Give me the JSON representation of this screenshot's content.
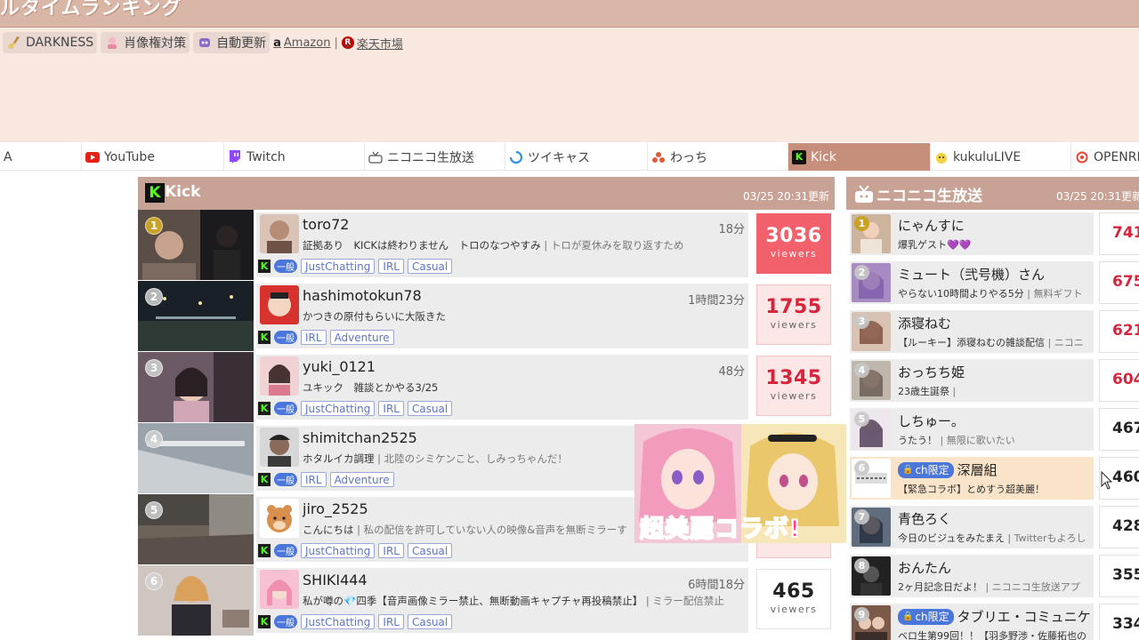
{
  "header": {
    "title": "ルタイムランキング",
    "tools": [
      {
        "icon": "broom-icon",
        "label": "DARKNESS"
      },
      {
        "icon": "portrait-icon",
        "label": "肖像権対策"
      },
      {
        "icon": "robot-icon",
        "label": "自動更新"
      }
    ],
    "amazon": "Amazon",
    "separator": "|",
    "rakuten": "楽天市場"
  },
  "tabs": [
    {
      "label": "A",
      "icon": ""
    },
    {
      "label": "YouTube",
      "icon": "youtube-icon"
    },
    {
      "label": "Twitch",
      "icon": "twitch-icon"
    },
    {
      "label": "ニコニコ生放送",
      "icon": "niconico-icon"
    },
    {
      "label": "ツイキャス",
      "icon": "twitcasting-icon"
    },
    {
      "label": "わっち",
      "icon": "wacchi-icon"
    },
    {
      "label": "Kick",
      "icon": "kick-icon"
    },
    {
      "label": "kukuluLIVE",
      "icon": "kukulu-icon"
    },
    {
      "label": "OPENRE",
      "icon": "openrec-icon"
    }
  ],
  "kick_panel": {
    "title": "Kick",
    "updated": "03/25 20:31更新",
    "viewers_label": "viewers",
    "ippan": "一般",
    "rows": [
      {
        "rank": "1",
        "name": "toro72",
        "duration": "18分",
        "title": "証拠あり　KICKは終わりません　トロのなつやすみ",
        "sub": " | トロが夏休みを取り返すため",
        "tags": [
          "JustChatting",
          "IRL",
          "Casual"
        ],
        "viewers": "3036"
      },
      {
        "rank": "2",
        "name": "hashimotokun78",
        "duration": "1時間23分",
        "title": "かつきの原付もらいに大阪きた",
        "sub": "",
        "tags": [
          "IRL",
          "Adventure"
        ],
        "viewers": "1755"
      },
      {
        "rank": "3",
        "name": "yuki_0121",
        "duration": "48分",
        "title": "ユキック　雑談とかやる3/25",
        "sub": "",
        "tags": [
          "JustChatting",
          "IRL",
          "Casual"
        ],
        "viewers": "1345"
      },
      {
        "rank": "4",
        "name": "shimitchan2525",
        "duration": "",
        "title": "ホタルイカ調理",
        "sub": " | 北陸のシミケンこと、しみっちゃんだ！",
        "tags": [
          "IRL",
          "Adventure"
        ],
        "viewers": ""
      },
      {
        "rank": "5",
        "name": "jiro_2525",
        "duration": "",
        "title": "こんにちは",
        "sub": " | 私の配信を許可していない人の映像&音声を無断ミラーす",
        "tags": [
          "JustChatting",
          "IRL",
          "Casual"
        ],
        "viewers": ""
      },
      {
        "rank": "6",
        "name": "SHIKI444",
        "duration": "6時間18分",
        "title": "私が噂の💎四季【音声画像ミラー禁止、無断動画キャプチャ再投稿禁止】",
        "sub": " | ミラー配信禁止",
        "tags": [
          "JustChatting",
          "IRL",
          "Casual"
        ],
        "viewers": "465"
      }
    ]
  },
  "nico_panel": {
    "title": "ニコニコ生放送",
    "updated": "03/25 20:31更新",
    "ch_badge": "ch限定",
    "rows": [
      {
        "rank": "1",
        "name": "にゃんすに",
        "sub": "爆乳ゲスト💜💜",
        "sub2": "",
        "ch": false,
        "viewers": "741"
      },
      {
        "rank": "2",
        "name": "ミュート（弐号機）さん",
        "sub": "やらない10時間よりやる5分",
        "sub2": " | 無料ギフト",
        "ch": false,
        "viewers": "675"
      },
      {
        "rank": "3",
        "name": "添寝ねむ",
        "sub": "【ルーキー】添寝ねむの雑談配信",
        "sub2": " | ニコニ",
        "ch": false,
        "viewers": "621"
      },
      {
        "rank": "4",
        "name": "おっちち姫",
        "sub": "23歳生誕祭",
        "sub2": " |",
        "ch": false,
        "viewers": "604"
      },
      {
        "rank": "5",
        "name": "しちゅー。",
        "sub": "うたう！",
        "sub2": " | 無限に歌いたい",
        "ch": false,
        "viewers": "467"
      },
      {
        "rank": "6",
        "name": "深層組",
        "sub": "【緊急コラボ】とめすう超美麗！",
        "sub2": "",
        "ch": true,
        "viewers": "460"
      },
      {
        "rank": "7",
        "name": "青色ろく",
        "sub": "今日のビジュをみたまえ",
        "sub2": " | Twitterもよろし",
        "ch": false,
        "viewers": "428"
      },
      {
        "rank": "8",
        "name": "おんたん",
        "sub": "2ヶ月記念日だよ！",
        "sub2": " | ニコニコ生放送アプ",
        "ch": false,
        "viewers": "355"
      },
      {
        "rank": "9",
        "name": "タブリエ・コミュニケ",
        "sub": "ベロ生第99回！！【羽多野渉・佐藤拓也の",
        "sub2": "",
        "ch": true,
        "viewers": "334"
      }
    ]
  },
  "collab": {
    "text": "超美麗コラボ!"
  },
  "colors": {
    "accent": "#c8a294",
    "kick_green": "#53fc18",
    "viewer_red": "#d9233a",
    "tag_blue": "#5f74c4"
  }
}
